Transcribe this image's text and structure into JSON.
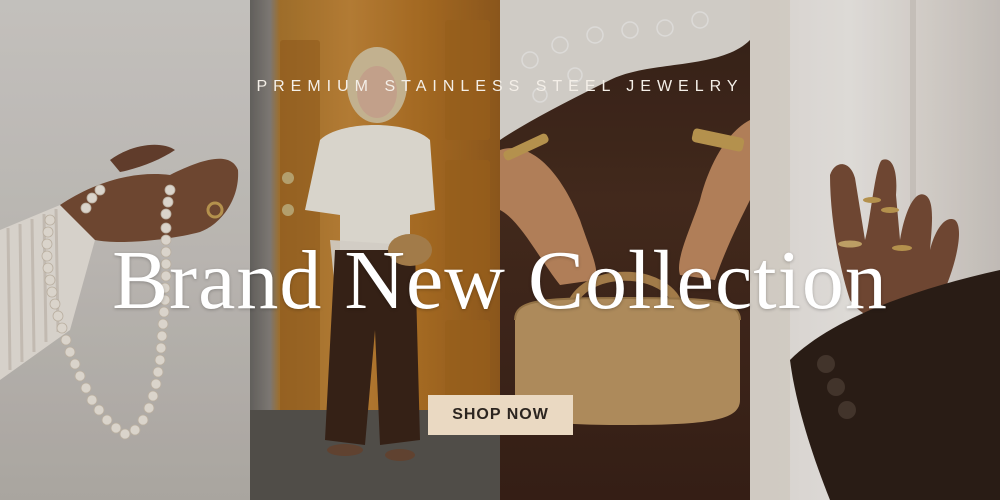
{
  "banner": {
    "tagline": "PREMIUM STAINLESS STEEL JEWELRY",
    "headline": "Brand New Collection",
    "cta_label": "SHOP NOW"
  },
  "colors": {
    "cta_background": "#ead9c2",
    "cta_text": "#2c2520",
    "headline_text": "#ffffff",
    "tagline_text": "#f4efe8"
  },
  "photos": [
    {
      "name": "hand-with-pearl-necklace-photo"
    },
    {
      "name": "woman-by-wooden-door-photo"
    },
    {
      "name": "hands-holding-suede-bag-photo"
    },
    {
      "name": "hand-with-gold-rings-photo"
    }
  ]
}
